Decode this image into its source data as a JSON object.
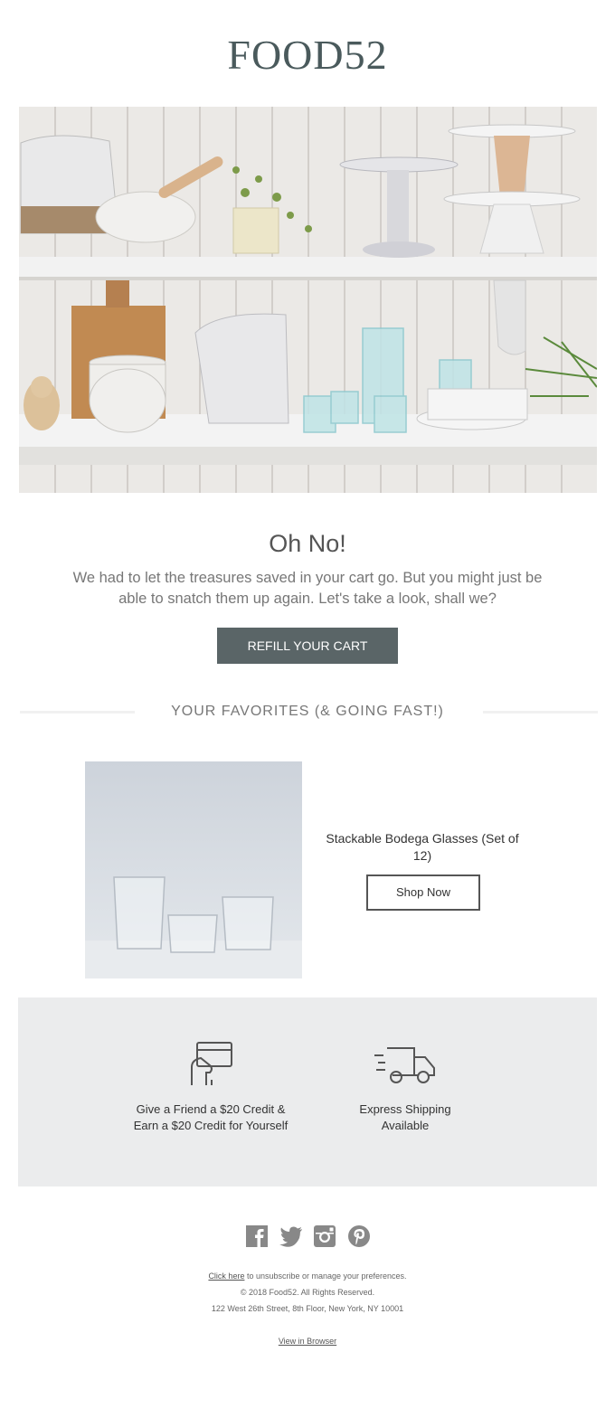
{
  "brand": {
    "logo_text": "FOOD52",
    "color": "#4a5a5c"
  },
  "hero": {
    "image_description_icon": "kitchen-shelves-photo"
  },
  "message": {
    "title": "Oh No!",
    "body": "We had to let the treasures saved in your cart go. But you might just be able to snatch them up again. Let's take a look, shall we?",
    "cta_label": "REFILL YOUR CART",
    "cta_color": "#5a6567"
  },
  "favorites": {
    "heading": "YOUR FAVORITES (& GOING FAST!)",
    "product": {
      "name": "Stackable Bodega Glasses (Set of 12)",
      "button_label": "Shop Now"
    }
  },
  "perks": {
    "items": [
      {
        "icon": "credit-card-hand-icon",
        "text": "Give a Friend a $20 Credit & Earn a $20 Credit for Yourself"
      },
      {
        "icon": "delivery-truck-icon",
        "text": "Express Shipping Available"
      }
    ],
    "background": "#ebeced"
  },
  "footer": {
    "social": [
      "facebook-icon",
      "twitter-icon",
      "instagram-icon",
      "pinterest-icon"
    ],
    "unsubscribe_link": "Click here",
    "unsubscribe_text": " to unsubscribe or manage your preferences.",
    "copyright": "© 2018 Food52. All Rights Reserved.",
    "address": "122 West 26th Street, 8th Floor, New York, NY 10001",
    "view_browser": "View in Browser"
  }
}
